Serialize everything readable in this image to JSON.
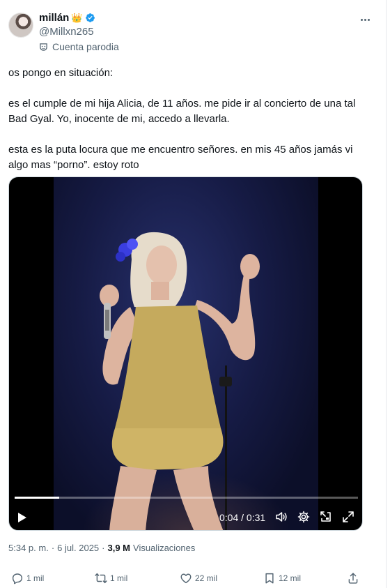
{
  "author": {
    "display_name": "millán",
    "emoji": "👑",
    "handle": "@Millxn265",
    "label": "Cuenta parodia"
  },
  "tweet": {
    "paragraphs": [
      "os pongo en situación:",
      "es el cumple de mi hija Alicia, de 11 años. me pide ir al concierto de una tal Bad Gyal. Yo, inocente de mi, accedo a llevarla.",
      "esta es la puta locura que me encuentro señores. en mis 45 años jamás vi algo mas “porno”. estoy roto"
    ]
  },
  "video": {
    "time": "0:04 / 0:31",
    "progress": 0.13
  },
  "meta": {
    "time": "5:34 p. m.",
    "separator1": "·",
    "date": "6 jul. 2025",
    "separator2": "·",
    "views_count": "3,9 M",
    "views_label": "Visualizaciones"
  },
  "actions": {
    "replies": "1 mil",
    "reposts": "1 mil",
    "likes": "22 mil",
    "bookmarks": "12 mil"
  },
  "colors": {
    "text": "#0f1419",
    "secondary": "#536471",
    "verified": "#1d9bf0"
  },
  "icons": [
    "verified-icon",
    "parody-mask-icon",
    "more-icon",
    "play-icon",
    "volume-icon",
    "settings-icon",
    "pip-icon",
    "fullscreen-icon",
    "reply-icon",
    "repost-icon",
    "like-icon",
    "bookmark-icon",
    "share-icon"
  ]
}
